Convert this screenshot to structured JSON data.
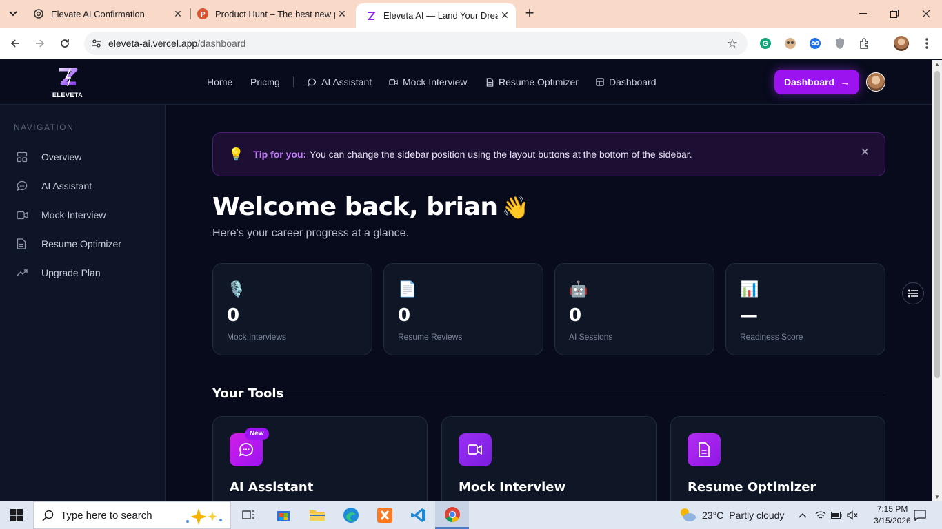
{
  "browser": {
    "tabs": [
      {
        "title": "Elevate AI Confirmation",
        "close": "✕",
        "active": false
      },
      {
        "title": "Product Hunt – The best new p",
        "close": "✕",
        "active": false
      },
      {
        "title": "Eleveta AI — Land Your Dream",
        "close": "✕",
        "active": true
      }
    ],
    "new_tab": "+",
    "url_host": "eleveta-ai.vercel.app",
    "url_path": "/dashboard"
  },
  "app": {
    "logo_text": "ELEVETA",
    "nav": {
      "home": "Home",
      "pricing": "Pricing",
      "ai_assistant": "AI Assistant",
      "mock_interview": "Mock Interview",
      "resume_optimizer": "Resume Optimizer",
      "dashboard": "Dashboard"
    },
    "cta_label": "Dashboard",
    "cta_arrow": "→"
  },
  "sidebar": {
    "heading": "NAVIGATION",
    "items": [
      {
        "label": "Overview",
        "icon": "overview-icon"
      },
      {
        "label": "AI Assistant",
        "icon": "chat-icon"
      },
      {
        "label": "Mock Interview",
        "icon": "video-icon"
      },
      {
        "label": "Resume Optimizer",
        "icon": "document-icon"
      },
      {
        "label": "Upgrade Plan",
        "icon": "trend-up-icon"
      }
    ]
  },
  "main": {
    "tip": {
      "bulb": "💡",
      "strong": "Tip for you:",
      "text": "You can change the sidebar position using the layout buttons at the bottom of the sidebar.",
      "close": "✕"
    },
    "welcome": "Welcome back, brian",
    "wave": "👋",
    "subtitle": "Here's your career progress at a glance.",
    "stats": [
      {
        "emoji": "🎙️",
        "value": "0",
        "label": "Mock Interviews"
      },
      {
        "emoji": "📄",
        "value": "0",
        "label": "Resume Reviews"
      },
      {
        "emoji": "🤖",
        "value": "0",
        "label": "AI Sessions"
      },
      {
        "emoji": "📊",
        "value": "—",
        "label": "Readiness Score"
      }
    ],
    "tools_title": "Your Tools",
    "tools": [
      {
        "title": "AI Assistant",
        "badge": "New",
        "color": "#c218e0"
      },
      {
        "title": "Mock Interview",
        "color": "#8b22f0"
      },
      {
        "title": "Resume Optimizer",
        "color": "#a51ef0"
      }
    ]
  },
  "taskbar": {
    "search_placeholder": "Type here to search",
    "weather_temp": "23°C",
    "weather_desc": "Partly cloudy",
    "time": "7:15 PM",
    "date": "3/15/2026"
  }
}
